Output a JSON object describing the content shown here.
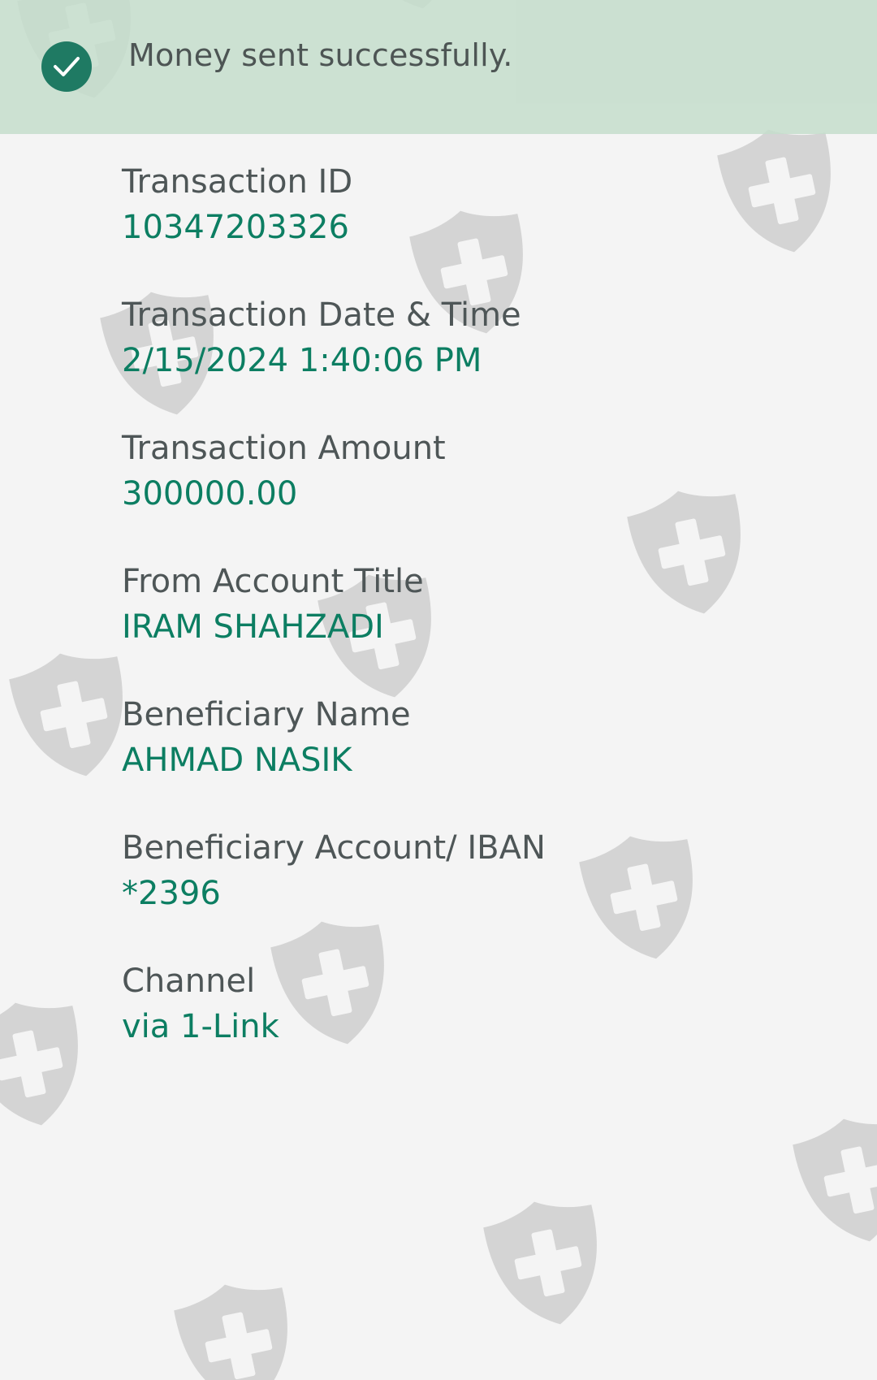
{
  "banner": {
    "message": "Money sent successfully.",
    "icon": "check-circle-icon",
    "accent_color": "#1f7a63"
  },
  "details": [
    {
      "label": "Transaction ID",
      "value": "10347203326"
    },
    {
      "label": "Transaction Date & Time",
      "value": "2/15/2024 1:40:06 PM"
    },
    {
      "label": "Transaction Amount",
      "value": "300000.00"
    },
    {
      "label": "From Account Title",
      "value": "IRAM SHAHZADI"
    },
    {
      "label": "Beneficiary Name",
      "value": "AHMAD NASIK"
    },
    {
      "label": "Beneficiary Account/ IBAN",
      "value": "*2396"
    },
    {
      "label": "Channel",
      "value": "via 1-Link"
    }
  ],
  "theme": {
    "label_color": "#4e5657",
    "value_color": "#0c7e62",
    "banner_bg": "#c4ddcb",
    "watermark_icon": "shield-plus-icon"
  }
}
